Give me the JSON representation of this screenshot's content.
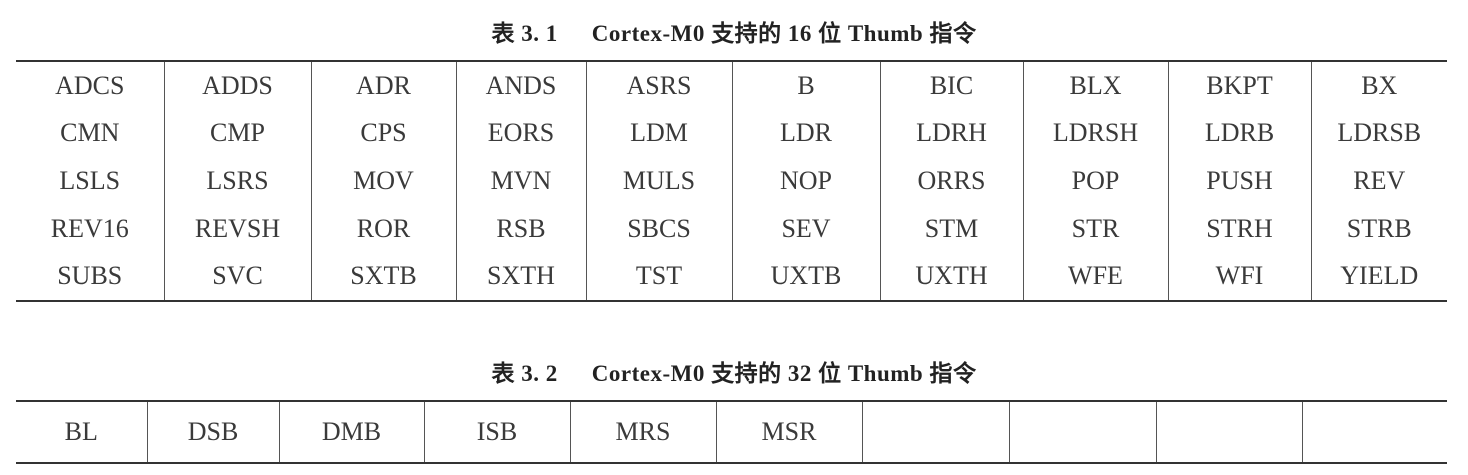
{
  "table1": {
    "caption_number": "表 3. 1",
    "caption_title": "Cortex-M0 支持的 16 位 Thumb 指令",
    "rows": [
      [
        "ADCS",
        "ADDS",
        "ADR",
        "ANDS",
        "ASRS",
        "B",
        "BIC",
        "BLX",
        "BKPT",
        "BX"
      ],
      [
        "CMN",
        "CMP",
        "CPS",
        "EORS",
        "LDM",
        "LDR",
        "LDRH",
        "LDRSH",
        "LDRB",
        "LDRSB"
      ],
      [
        "LSLS",
        "LSRS",
        "MOV",
        "MVN",
        "MULS",
        "NOP",
        "ORRS",
        "POP",
        "PUSH",
        "REV"
      ],
      [
        "REV16",
        "REVSH",
        "ROR",
        "RSB",
        "SBCS",
        "SEV",
        "STM",
        "STR",
        "STRH",
        "STRB"
      ],
      [
        "SUBS",
        "SVC",
        "SXTB",
        "SXTH",
        "TST",
        "UXTB",
        "UXTH",
        "WFE",
        "WFI",
        "YIELD"
      ]
    ]
  },
  "table2": {
    "caption_number": "表 3. 2",
    "caption_title": "Cortex-M0 支持的 32 位 Thumb 指令",
    "rows": [
      [
        "BL",
        "DSB",
        "DMB",
        "ISB",
        "MRS",
        "MSR",
        "",
        "",
        "",
        ""
      ]
    ]
  }
}
